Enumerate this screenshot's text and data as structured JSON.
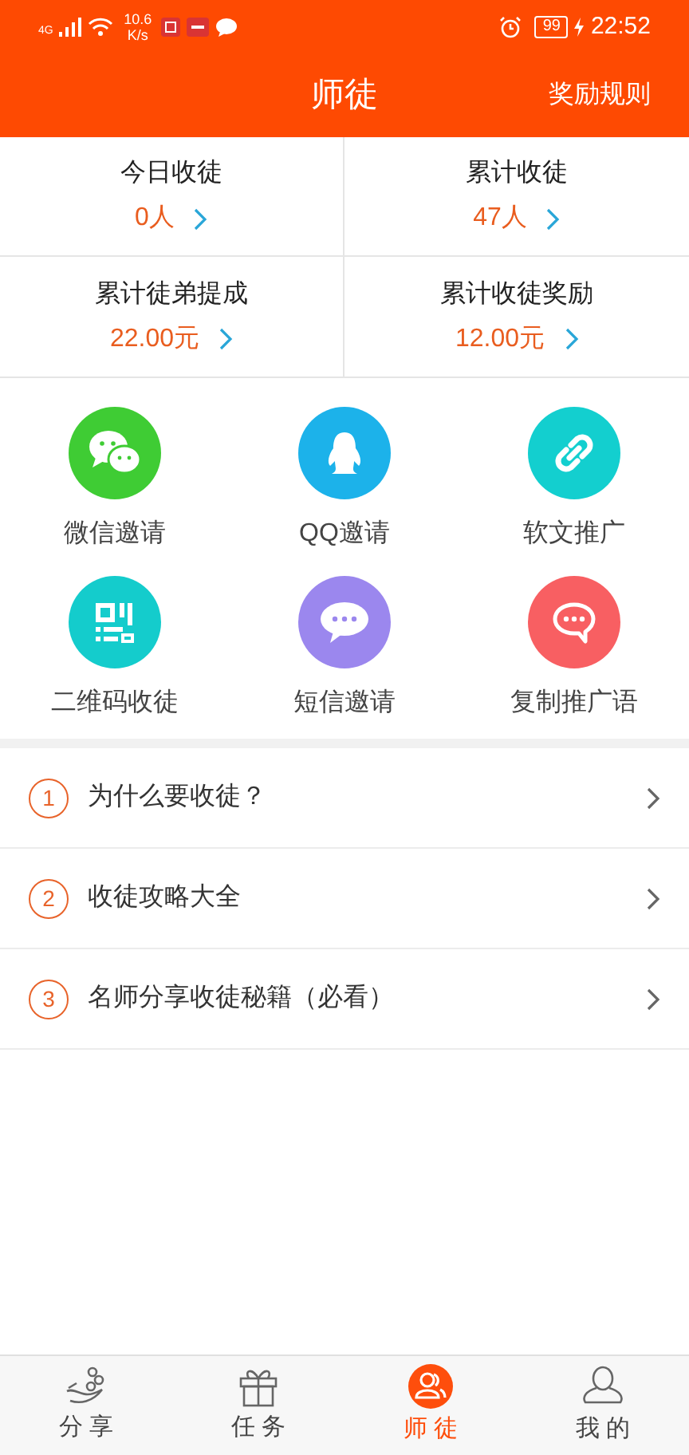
{
  "status_bar": {
    "network": "4G",
    "speed": "10.6 K/s",
    "battery": "99",
    "time": "22:52"
  },
  "header": {
    "title": "师徒",
    "action": "奖励规则"
  },
  "stats": [
    {
      "label": "今日收徒",
      "value": "0人"
    },
    {
      "label": "累计收徒",
      "value": "47人"
    },
    {
      "label": "累计徒弟提成",
      "value": "22.00元"
    },
    {
      "label": "累计收徒奖励",
      "value": "12.00元"
    }
  ],
  "actions": [
    {
      "label": "微信邀请",
      "kind": "wechat",
      "color": "#3fcc34"
    },
    {
      "label": "QQ邀请",
      "kind": "qq",
      "color": "#1cb2ea"
    },
    {
      "label": "软文推广",
      "kind": "link",
      "color": "#13cfcf"
    },
    {
      "label": "二维码收徒",
      "kind": "qrcode",
      "color": "#14cccc"
    },
    {
      "label": "短信邀请",
      "kind": "sms",
      "color": "#9b87ee"
    },
    {
      "label": "复制推广语",
      "kind": "copy",
      "color": "#f85f62"
    }
  ],
  "guides": [
    {
      "number": "1",
      "title": "为什么要收徒？"
    },
    {
      "number": "2",
      "title": "收徒攻略大全"
    },
    {
      "number": "3",
      "title": "名师分享收徒秘籍（必看）"
    }
  ],
  "tabs": [
    {
      "label": "分 享",
      "kind": "share",
      "selected": false
    },
    {
      "label": "任 务",
      "kind": "gift",
      "selected": false
    },
    {
      "label": "师 徒",
      "kind": "people",
      "selected": true
    },
    {
      "label": "我 的",
      "kind": "person",
      "selected": false
    }
  ]
}
